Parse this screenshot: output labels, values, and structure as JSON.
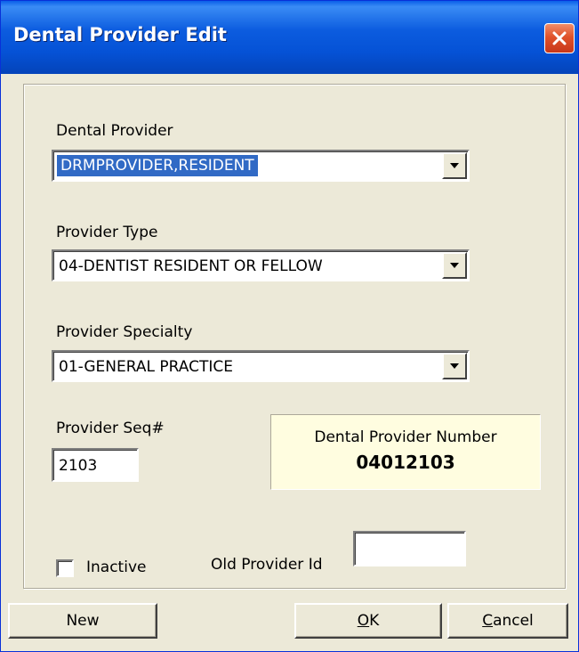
{
  "window": {
    "title": "Dental Provider Edit"
  },
  "form": {
    "dental_provider": {
      "label": "Dental Provider",
      "value": "DRMPROVIDER,RESIDENT"
    },
    "provider_type": {
      "label": "Provider Type",
      "value": "04-DENTIST RESIDENT OR FELLOW"
    },
    "provider_specialty": {
      "label": "Provider Specialty",
      "value": "01-GENERAL PRACTICE"
    },
    "provider_seq": {
      "label": "Provider Seq#",
      "value": "2103"
    },
    "provider_number": {
      "label": "Dental Provider Number",
      "value": "04012103"
    },
    "inactive": {
      "label": "Inactive",
      "checked": false
    },
    "old_provider_id": {
      "label": "Old Provider Id",
      "value": ""
    }
  },
  "buttons": {
    "new": "New",
    "ok": {
      "mnemonic": "O",
      "rest": "K"
    },
    "cancel": {
      "mnemonic": "C",
      "rest": "ancel"
    }
  },
  "icons": {
    "close": "close-icon",
    "dropdown": "chevron-down-icon"
  },
  "colors": {
    "titlebar": "#0552d6",
    "selection": "#316ac5",
    "panel_bg": "#fffde0",
    "close_button": "#e0522a"
  }
}
